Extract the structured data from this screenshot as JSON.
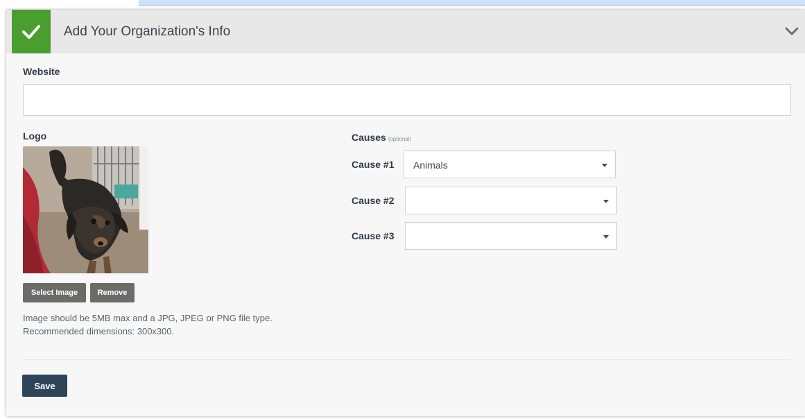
{
  "header": {
    "title": "Add Your Organization's Info",
    "check_icon": "check-icon",
    "chevron_icon": "chevron-down-icon"
  },
  "website": {
    "label": "Website",
    "value": "",
    "placeholder": ""
  },
  "logo": {
    "label": "Logo",
    "image_icon": "dog-photo",
    "select_label": "Select Image",
    "remove_label": "Remove",
    "help_line1": "Image should be 5MB max and a JPG, JPEG or PNG file type.",
    "help_line2": "Recommended dimensions: 300x300."
  },
  "causes": {
    "label": "Causes",
    "optional": "(optional)",
    "items": [
      {
        "label": "Cause #1",
        "value": "Animals"
      },
      {
        "label": "Cause #2",
        "value": ""
      },
      {
        "label": "Cause #3",
        "value": ""
      }
    ]
  },
  "save_label": "Save",
  "colors": {
    "check_green": "#4a9e2f",
    "save_navy": "#2e4459",
    "button_gray": "#6b6b68",
    "header_bg": "#e8e8e8"
  }
}
